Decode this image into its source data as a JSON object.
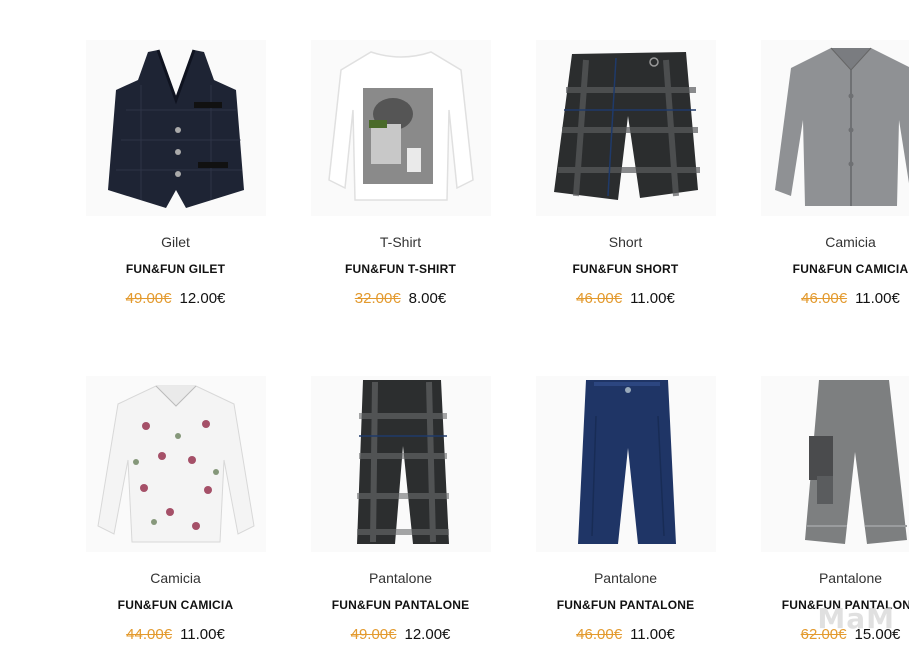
{
  "products": [
    {
      "category": "Gilet",
      "name": "FUN&FUN GILET",
      "old_price": "49.00€",
      "price": "12.00€",
      "icon": "vest-icon"
    },
    {
      "category": "T-Shirt",
      "name": "FUN&FUN T-SHIRT",
      "old_price": "32.00€",
      "price": "8.00€",
      "icon": "tshirt-icon"
    },
    {
      "category": "Short",
      "name": "FUN&FUN SHORT",
      "old_price": "46.00€",
      "price": "11.00€",
      "icon": "shorts-icon"
    },
    {
      "category": "Camicia",
      "name": "FUN&FUN CAMICIA",
      "old_price": "46.00€",
      "price": "11.00€",
      "icon": "shirt-icon"
    },
    {
      "category": "Camicia",
      "name": "FUN&FUN CAMICIA",
      "old_price": "44.00€",
      "price": "11.00€",
      "icon": "shirt-icon"
    },
    {
      "category": "Pantalone",
      "name": "FUN&FUN PANTALONE",
      "old_price": "49.00€",
      "price": "12.00€",
      "icon": "trousers-icon"
    },
    {
      "category": "Pantalone",
      "name": "FUN&FUN PANTALONE",
      "old_price": "46.00€",
      "price": "11.00€",
      "icon": "trousers-icon"
    },
    {
      "category": "Pantalone",
      "name": "FUN&FUN PANTALONE",
      "old_price": "62.00€",
      "price": "15.00€",
      "icon": "trousers-icon"
    }
  ],
  "watermark": {
    "text": "MaM"
  },
  "colors": {
    "old_price": "#e39a2e",
    "text": "#111111"
  }
}
